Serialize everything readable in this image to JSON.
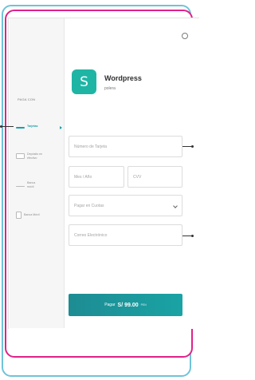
{
  "sidebar": {
    "heading": "PAGA CON",
    "items": [
      {
        "label": "Tarjetas",
        "active": true
      },
      {
        "label": "Depósito en efectivo",
        "active": false
      },
      {
        "label": "Banca móvil",
        "active": false
      },
      {
        "label": "Banca Móvil",
        "active": false
      }
    ]
  },
  "brand": {
    "logo_symbol": "S",
    "name": "Wordpress",
    "subtitle": "polera"
  },
  "form": {
    "card_number_placeholder": "Número de Tarjeta",
    "expiry_placeholder": "Mes / Año",
    "cvv_placeholder": "CVV",
    "installments_placeholder": "Pagar en Cuotas",
    "email_placeholder": "Correo Electrónico"
  },
  "pay_button": {
    "label": "Pagar",
    "amount": "S/ 99.00",
    "currency": "PEN"
  },
  "colors": {
    "accent": "#19a0aa",
    "logo": "#1fb5a5",
    "frame_pink": "#e0218a",
    "frame_blue": "#6fc3d8"
  },
  "icons": {
    "close": "close-icon",
    "caret": "chevron-down-icon"
  }
}
